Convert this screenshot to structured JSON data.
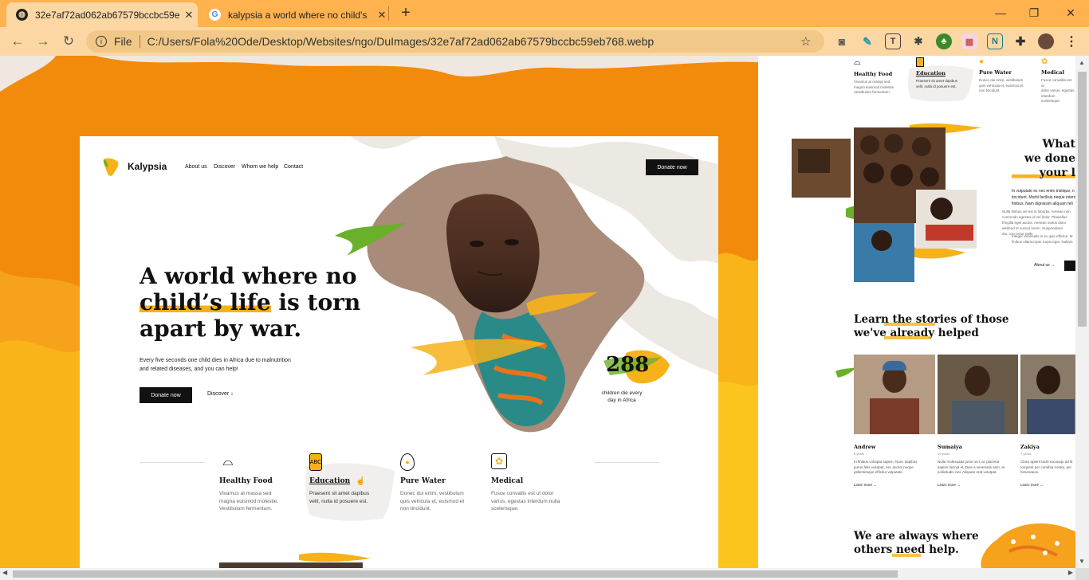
{
  "browser": {
    "tabs": [
      {
        "title": "32e7af72ad062ab67579bccbc59e",
        "active": true
      },
      {
        "title": "kalypsia a world where no child's",
        "active": false
      }
    ],
    "new_tab": "+",
    "file_label": "File",
    "url": "C:/Users/Fola%20Ode/Desktop/Websites/ngo/DuImages/32e7af72ad062ab67579bccbc59eb768.webp"
  },
  "page": {
    "brand": "Kalypsia",
    "nav": [
      "About us",
      "Discover",
      "Whom we help",
      "Contact"
    ],
    "donate_header": "Donate now",
    "hero": {
      "line1": "A world where no",
      "line2_highlight": "child’s life",
      "line2_rest": " is torn",
      "line3": "apart by war.",
      "sub1": "Every five seconds one child dies in Africa due to malnutrition",
      "sub2": "and related diseases, and you can help!",
      "donate": "Donate now",
      "discover": "Discover",
      "discover_arrow": "↓"
    },
    "stat": {
      "number": "288",
      "label1": "children die every",
      "label2": "day in Africa"
    },
    "services": [
      {
        "title": "Healthy Food",
        "lines": [
          "Vivamus at massa sed",
          "magna euismod molestie.",
          "Vestibulum fermentum."
        ]
      },
      {
        "title": "Education",
        "lines": [
          "Praesent sit amet dapibus",
          "velit, nulla id posuere est."
        ]
      },
      {
        "title": "Pure Water",
        "lines": [
          "Donec dui enim, vestibulum",
          "quis vehicula et, euismod et",
          "non tincidunt."
        ]
      },
      {
        "title": "Medical",
        "lines": [
          "Fusce convallis est ut dolor",
          "varius, egestas interdum nulla",
          "scelerisque."
        ]
      }
    ]
  },
  "right": {
    "services": [
      {
        "title": "Healthy Food",
        "lines": [
          "Vivamus at massa sed",
          "magna euismod molestie.",
          "Vestibulum fermentum."
        ]
      },
      {
        "title": "Education",
        "lines": [
          "Praesent sit amet dapibus",
          "velit, nulla id posuere est."
        ]
      },
      {
        "title": "Pure Water",
        "lines": [
          "Donec dui enim, vestibulum",
          "quis vehicula et, euismod et",
          "non tincidunt."
        ]
      },
      {
        "title": "Medical",
        "lines": [
          "Fusce convallis est ut",
          "dolor varius, egestas interdum",
          "scelerisque."
        ]
      }
    ],
    "what_title": [
      "What",
      "we done",
      "your l"
    ],
    "what_text": [
      "In vulputate ex nec enim tristique, n",
      "tincidunt. Morbi facilisis neque interdu",
      "finibus. Nam dignissim aliquam feli"
    ],
    "what_small": [
      "Nulla finibus vel est in lobortis. Aenean non",
      "commodo egestas id vel dolor. Phasellus",
      "fringilla eget auctor. Aenean metus dolor",
      "eleifend et cursus lorem. Suspendisse",
      "dui, non tortor pelle"
    ],
    "what_small2": [
      "Integer venenatis in ex quis efficitur. M",
      "finibus ullamcorper turpis eget. Nullam"
    ],
    "about_link": "About us",
    "stories_title": [
      "Learn the stories of those",
      "we've already helped"
    ],
    "people": [
      {
        "name": "Andrew",
        "age": "8 years",
        "text": [
          "In finibus volutpat sapien. Nunc dapibus",
          "purus felis volutpat, nec auctor neque",
          "pellentesque efficitur vulputate."
        ],
        "link": "Learn more"
      },
      {
        "name": "Sumaiya",
        "age": "10 years",
        "text": [
          "Nulla molesuada justo orci, ac placerat",
          "sapien lacinia et. Duis a venenatis sem, at",
          "sollicitudin nisi. Aliquam erat volutpat."
        ],
        "link": "Learn more"
      },
      {
        "name": "Zakiya",
        "age": "7 years",
        "text": [
          "Class aptent taciti sociosqu ad lit",
          "torquent per conubia nostra, per",
          "himenaeos."
        ],
        "link": "Learn more"
      }
    ],
    "always_title": [
      "We are always where",
      "others need help."
    ]
  }
}
